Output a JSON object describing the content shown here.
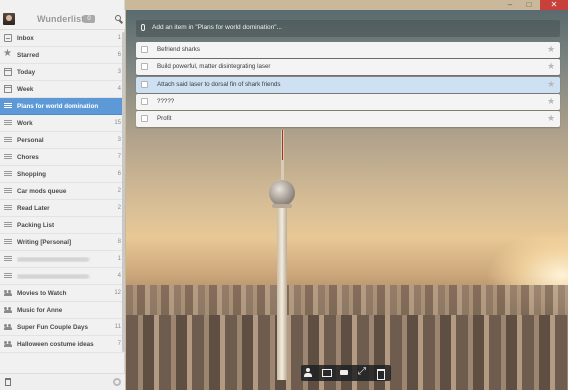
{
  "window": {
    "minimize_glyph": "–",
    "maximize_glyph": "□",
    "close_glyph": "✕"
  },
  "app": {
    "title": "Wunderlist",
    "badge": "0"
  },
  "sidebar": {
    "items": [
      {
        "label": "Inbox",
        "count": "1",
        "icon": "inbox-icon"
      },
      {
        "label": "Starred",
        "count": "6",
        "icon": "star-icon"
      },
      {
        "label": "Today",
        "count": "3",
        "icon": "calendar-icon"
      },
      {
        "label": "Week",
        "count": "4",
        "icon": "calendar-icon"
      },
      {
        "label": "Plans for world domination",
        "count": "",
        "icon": "list-icon",
        "active": true
      },
      {
        "label": "Work",
        "count": "15",
        "icon": "list-icon"
      },
      {
        "label": "Personal",
        "count": "3",
        "icon": "list-icon"
      },
      {
        "label": "Chores",
        "count": "7",
        "icon": "list-icon"
      },
      {
        "label": "Shopping",
        "count": "6",
        "icon": "list-icon"
      },
      {
        "label": "Car mods queue",
        "count": "2",
        "icon": "list-icon"
      },
      {
        "label": "Read Later",
        "count": "2",
        "icon": "list-icon"
      },
      {
        "label": "Packing List",
        "count": "",
        "icon": "list-icon"
      },
      {
        "label": "Writing [Personal]",
        "count": "8",
        "icon": "list-icon"
      },
      {
        "label": "",
        "count": "1",
        "icon": "list-icon",
        "blurred": true
      },
      {
        "label": "",
        "count": "4",
        "icon": "list-icon",
        "blurred": true
      },
      {
        "label": "Movies to Watch",
        "count": "12",
        "icon": "shared-list-icon"
      },
      {
        "label": "Music for Anne",
        "count": "",
        "icon": "shared-list-icon"
      },
      {
        "label": "Super Fun Couple Days",
        "count": "11",
        "icon": "shared-list-icon"
      },
      {
        "label": "Halloween costume ideas",
        "count": "7",
        "icon": "shared-list-icon"
      }
    ]
  },
  "main": {
    "add_placeholder": "Add an item in \"Plans for world domination\"...",
    "tasks": [
      {
        "title": "Befriend sharks",
        "selected": false
      },
      {
        "title": "Build powerful, matter disintegrating laser",
        "selected": false
      },
      {
        "title": "Attach said laser to dorsal fin of shark friends",
        "selected": true
      },
      {
        "title": "?????",
        "selected": false
      },
      {
        "title": "Profit",
        "selected": false
      }
    ],
    "star_glyph": "★"
  },
  "toolbar": {
    "buttons": [
      "share-icon",
      "email-icon",
      "print-icon",
      "fullscreen-icon",
      "delete-icon"
    ]
  },
  "colors": {
    "accent": "#5c99d6",
    "close_button": "#c7403a",
    "selected_task": "#cde1f2"
  }
}
